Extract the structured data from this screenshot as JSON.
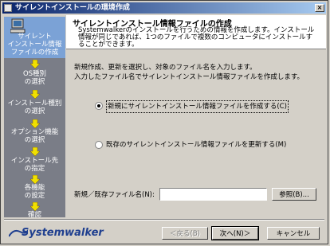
{
  "window": {
    "title": "サイレントインストールの環境作成",
    "close_label": "×"
  },
  "sidebar": {
    "steps": [
      {
        "label": "サイレント インストール情報 ファイルの作成",
        "lines": [
          "サイレント",
          "インストール情報",
          "ファイルの作成"
        ],
        "active": true
      },
      {
        "label": "OS種別 の選択",
        "lines": [
          "OS種別",
          "の選択"
        ],
        "active": false
      },
      {
        "label": "インストール種別 の選択",
        "lines": [
          "インストール種別",
          "の選択"
        ],
        "active": false
      },
      {
        "label": "オプション機能 の選択",
        "lines": [
          "オプション機能",
          "の選択"
        ],
        "active": false
      },
      {
        "label": "インストール先 の指定",
        "lines": [
          "インストール先",
          "の指定"
        ],
        "active": false
      },
      {
        "label": "各機能 の設定",
        "lines": [
          "各機能",
          "の設定"
        ],
        "active": false
      },
      {
        "label": "確認",
        "lines": [
          "確認"
        ],
        "active": false
      }
    ]
  },
  "header": {
    "title": "サイレントインストール情報ファイルの作成",
    "desc": "Systemwalkerのインストールを行うための情報を作成します。インストール情報が同じであれば、1つのファイルで複数のコンピュータにインストールすることができます。"
  },
  "instructions": {
    "line1": "新規作成、更新を選択し、対象のファイル名を入力します。",
    "line2": "入力したファイル名でサイレントインストール情報ファイルを作成します。"
  },
  "options": {
    "new_label": "新規にサイレントインストール情報ファイルを作成する(C)",
    "update_label": "既存のサイレントインストール情報ファイルを更新する(M)",
    "selected": "new"
  },
  "file": {
    "label": "新規／既存ファイル名(N):",
    "value": "",
    "browse_label": "参照(B)..."
  },
  "footer": {
    "brand": "Systemwalker",
    "back_label": "＜戻る(B)",
    "next_label": "次へ(N)＞",
    "cancel_label": "キャンセル"
  }
}
